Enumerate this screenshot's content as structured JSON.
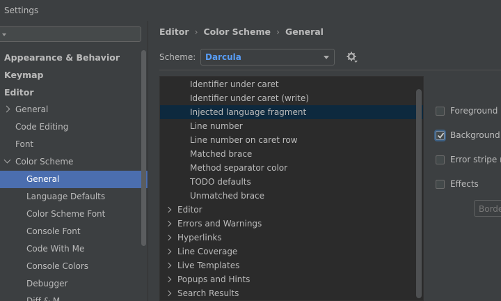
{
  "window": {
    "title": "Settings"
  },
  "sidebar": {
    "items": [
      {
        "label": "Appearance & Behavior"
      },
      {
        "label": "Keymap"
      },
      {
        "label": "Editor"
      },
      {
        "label": "General"
      },
      {
        "label": "Code Editing"
      },
      {
        "label": "Font"
      },
      {
        "label": "Color Scheme"
      },
      {
        "label": "General"
      },
      {
        "label": "Language Defaults"
      },
      {
        "label": "Color Scheme Font"
      },
      {
        "label": "Console Font"
      },
      {
        "label": "Code With Me"
      },
      {
        "label": "Console Colors"
      },
      {
        "label": "Debugger"
      },
      {
        "label": "Diff & M"
      }
    ]
  },
  "breadcrumb": [
    "Editor",
    "Color Scheme",
    "General"
  ],
  "scheme": {
    "label": "Scheme:",
    "value": "Darcula"
  },
  "list": {
    "items": [
      {
        "label": "Identifier under caret"
      },
      {
        "label": "Identifier under caret (write)"
      },
      {
        "label": "Injected language fragment"
      },
      {
        "label": "Line number"
      },
      {
        "label": "Line number on caret row"
      },
      {
        "label": "Matched brace"
      },
      {
        "label": "Method separator color"
      },
      {
        "label": "TODO defaults"
      },
      {
        "label": "Unmatched brace"
      },
      {
        "label": "Editor"
      },
      {
        "label": "Errors and Warnings"
      },
      {
        "label": "Hyperlinks"
      },
      {
        "label": "Line Coverage"
      },
      {
        "label": "Live Templates"
      },
      {
        "label": "Popups and Hints"
      },
      {
        "label": "Search Results"
      }
    ]
  },
  "options": {
    "foreground": {
      "label": "Foreground",
      "checked": false
    },
    "background": {
      "label": "Background",
      "checked": true
    },
    "error_stripe": {
      "label": "Error stripe m",
      "checked": false
    },
    "effects": {
      "label": "Effects",
      "checked": false
    },
    "border_button": "Borde"
  },
  "colors": {
    "selection": "#4b6eaf",
    "list_selection": "#0d293e",
    "scheme_value": "#589df6"
  }
}
